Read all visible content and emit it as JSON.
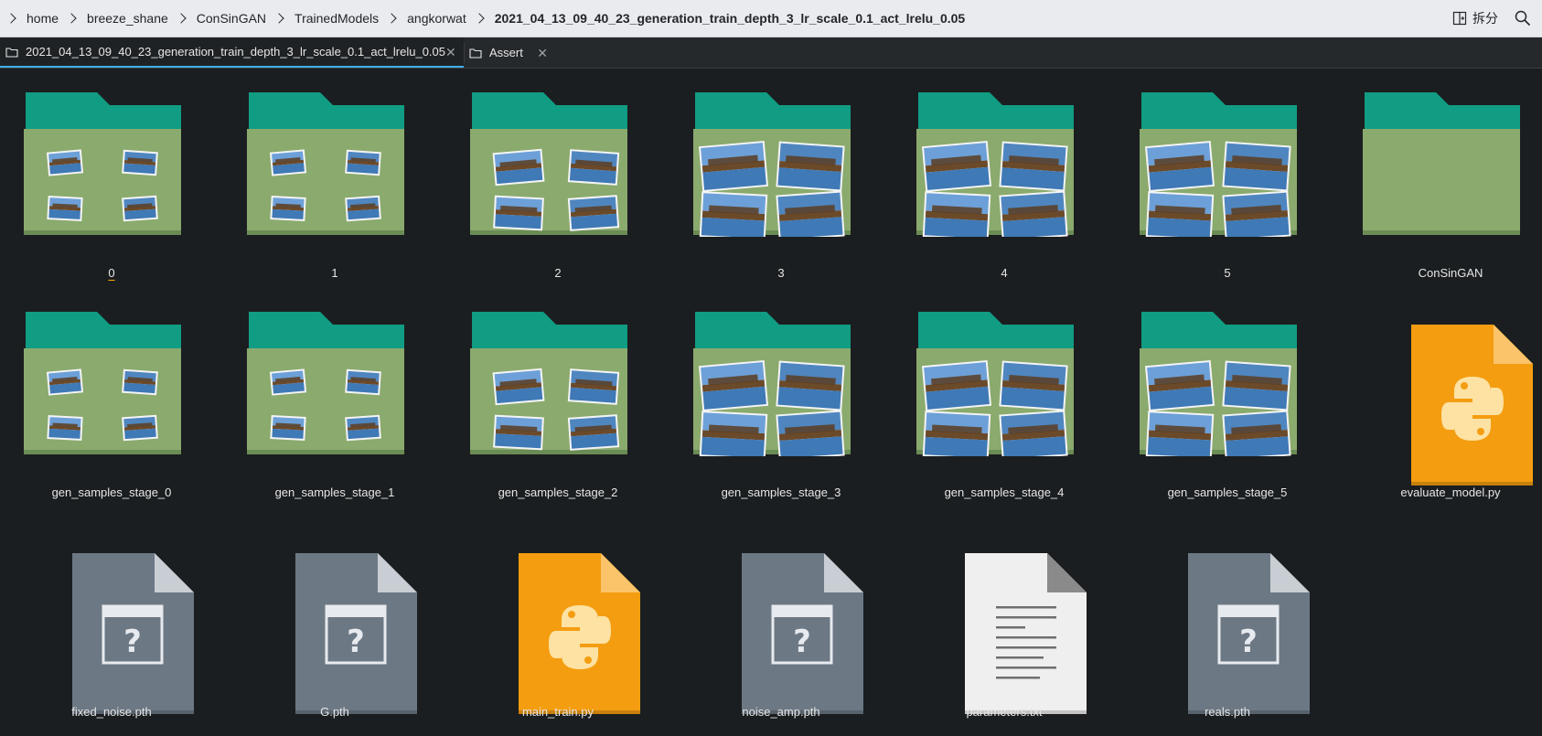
{
  "breadcrumb": [
    "home",
    "breeze_shane",
    "ConSinGAN",
    "TrainedModels",
    "angkorwat",
    "2021_04_13_09_40_23_generation_train_depth_3_lr_scale_0.1_act_lrelu_0.05"
  ],
  "toolbar": {
    "split_label": "拆分"
  },
  "tabs": [
    {
      "label": "2021_04_13_09_40_23_generation_train_depth_3_lr_scale_0.1_act_lrelu_0.05"
    },
    {
      "label": "Assert"
    }
  ],
  "items": [
    {
      "name": "0",
      "type": "folder",
      "photos": 4
    },
    {
      "name": "1",
      "type": "folder",
      "photos": 4
    },
    {
      "name": "2",
      "type": "folder",
      "photos": 4
    },
    {
      "name": "3",
      "type": "folder",
      "photos": 4
    },
    {
      "name": "4",
      "type": "folder",
      "photos": 4
    },
    {
      "name": "5",
      "type": "folder",
      "photos": 4
    },
    {
      "name": "ConSinGAN",
      "type": "folder",
      "photos": 0
    },
    {
      "name": "gen_samples_stage_0",
      "type": "folder",
      "photos": 4
    },
    {
      "name": "gen_samples_stage_1",
      "type": "folder",
      "photos": 4
    },
    {
      "name": "gen_samples_stage_2",
      "type": "folder",
      "photos": 4
    },
    {
      "name": "gen_samples_stage_3",
      "type": "folder",
      "photos": 4
    },
    {
      "name": "gen_samples_stage_4",
      "type": "folder",
      "photos": 4
    },
    {
      "name": "gen_samples_stage_5",
      "type": "folder",
      "photos": 4
    },
    {
      "name": "evaluate_model.py",
      "type": "python"
    },
    {
      "name": "fixed_noise.pth",
      "type": "unknown"
    },
    {
      "name": "G.pth",
      "type": "unknown"
    },
    {
      "name": "main_train.py",
      "type": "python"
    },
    {
      "name": "noise_amp.pth",
      "type": "unknown"
    },
    {
      "name": "parameters.txt",
      "type": "text"
    },
    {
      "name": "reals.pth",
      "type": "unknown"
    }
  ],
  "colors": {
    "folder_front": "#8aaa6e",
    "folder_back": "#119c84",
    "python_file": "#f49d10",
    "unknown_file": "#6c7884",
    "text_file": "#efefef",
    "selection_underline": "#f6a800"
  }
}
